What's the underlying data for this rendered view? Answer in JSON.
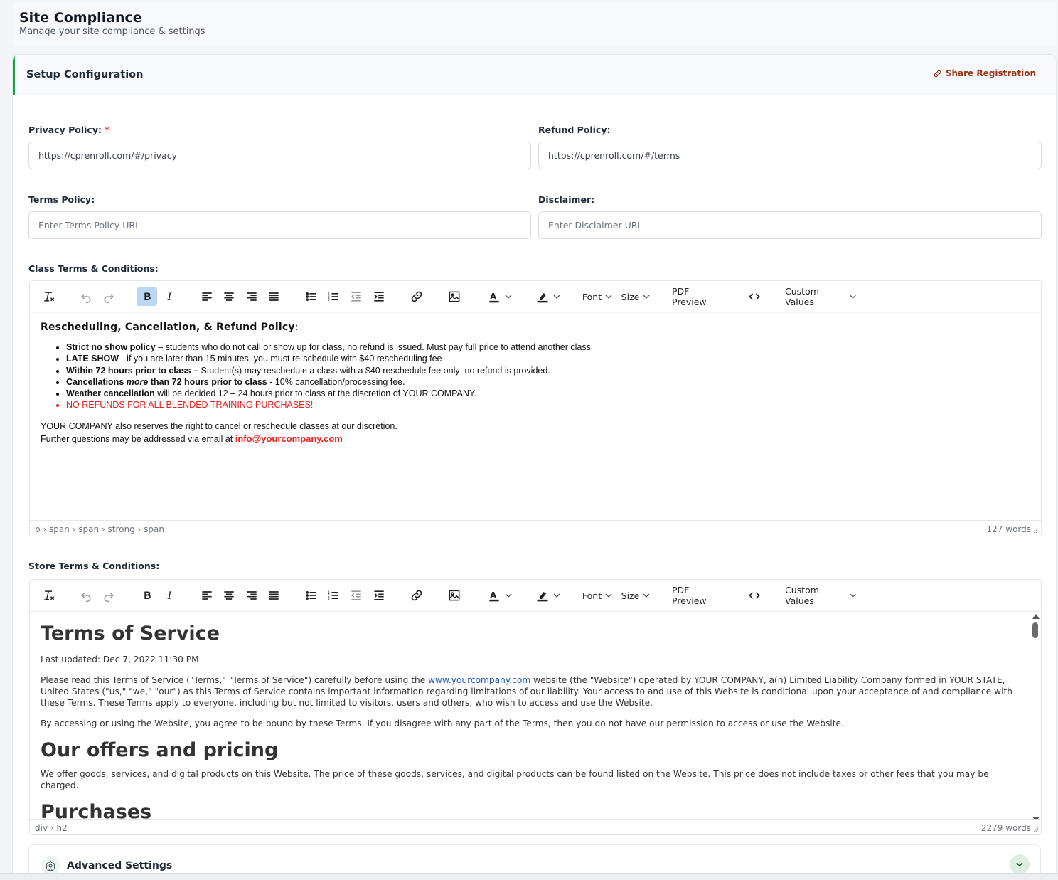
{
  "header": {
    "title": "Site Compliance",
    "subtitle": "Manage your site compliance & settings"
  },
  "card": {
    "title": "Setup Configuration",
    "share_label": "Share Registration",
    "accent_color": "#16a34a"
  },
  "fields": {
    "privacy": {
      "label": "Privacy Policy:",
      "required": "*",
      "value": "https://cprenroll.com/#/privacy"
    },
    "refund": {
      "label": "Refund Policy:",
      "value": "https://cprenroll.com/#/terms"
    },
    "terms": {
      "label": "Terms Policy:",
      "placeholder": "Enter Terms Policy URL"
    },
    "disclaimer": {
      "label": "Disclaimer:",
      "placeholder": "Enter Disclaimer URL"
    }
  },
  "toolbar": {
    "font_label": "Font",
    "size_label": "Size",
    "pdf_preview_label": "PDF Preview",
    "custom_values_label": "Custom Values",
    "icons": [
      "clear-format-icon",
      "undo-icon",
      "redo-icon",
      "bold-icon",
      "italic-icon",
      "align-left-icon",
      "align-center-icon",
      "align-right-icon",
      "justify-icon",
      "bullet-list-icon",
      "numbered-list-icon",
      "outdent-icon",
      "indent-icon",
      "link-icon",
      "image-icon",
      "text-color-icon",
      "highlight-icon",
      "source-code-icon"
    ]
  },
  "class_terms": {
    "label": "Class Terms & Conditions:",
    "heading": "Rescheduling, Cancellation, & Refund Policy",
    "heading_suffix": ":",
    "items": [
      {
        "bold": "Strict no show policy",
        "text": " – students who do not call or show up for class, no refund is issued. Must pay full price to attend another class"
      },
      {
        "bold": "LATE SHOW",
        "text": " - if you are later than 15 minutes, you must re-schedule with $40 rescheduling fee"
      },
      {
        "bold": "Within 72 hours prior to class –",
        "text": " Student(s) may reschedule a class with a $40 reschedule fee only; no refund is provided."
      },
      {
        "bold_a": "Cancellations ",
        "italic": "more",
        "bold_b": " than 72 hours prior to class",
        "text": " - 10% cancellation/processing fee."
      },
      {
        "bold": "Weather cancellation",
        "text": " will be decided 12 – 24 hours prior to class at the discretion of YOUR COMPANY."
      },
      {
        "red": "NO REFUNDS FOR ALL BLENDED TRAINING PURCHASES!"
      }
    ],
    "para1": "YOUR COMPANY also reserves the right to cancel or reschedule classes at our discretion.",
    "para2_prefix": "Further questions may be addressed via email at ",
    "email": "info@yourcompany.com",
    "status_path": "p › span › span › strong › span",
    "word_count": "127 words"
  },
  "store_terms": {
    "label": "Store Terms & Conditions:",
    "h1": "Terms of Service",
    "updated": "Last updated: Dec 7, 2022 11:30 PM",
    "p1_a": "Please read this Terms of Service (\"Terms,\" \"Terms of Service\") carefully before using the ",
    "p1_link": "www.yourcompany.com",
    "p1_b": " website (the \"Website\") operated by YOUR COMPANY, a(n) Limited Liability Company formed in YOUR STATE, United States (\"us,\" \"we,\" \"our\") as this Terms of Service contains important information regarding limitations of our liability. Your access to and use of this Website is conditional upon your acceptance of and compliance with these Terms. These Terms apply to everyone, including but not limited to visitors, users and others, who wish to access and use the Website.",
    "p2": "By accessing or using the Website, you agree to be bound by these Terms. If you disagree with any part of the Terms, then you do not have our permission to access or use the Website.",
    "h2_a": "Our offers and pricing",
    "p3": "We offer goods, services, and digital products on this Website. The price of these goods, services, and digital products can be found listed on the Website. This price does not include taxes or other fees that you may be charged.",
    "h2_b": "Purchases",
    "status_path": "div › h2",
    "word_count": "2279 words"
  },
  "advanced": {
    "title": "Advanced Settings"
  }
}
